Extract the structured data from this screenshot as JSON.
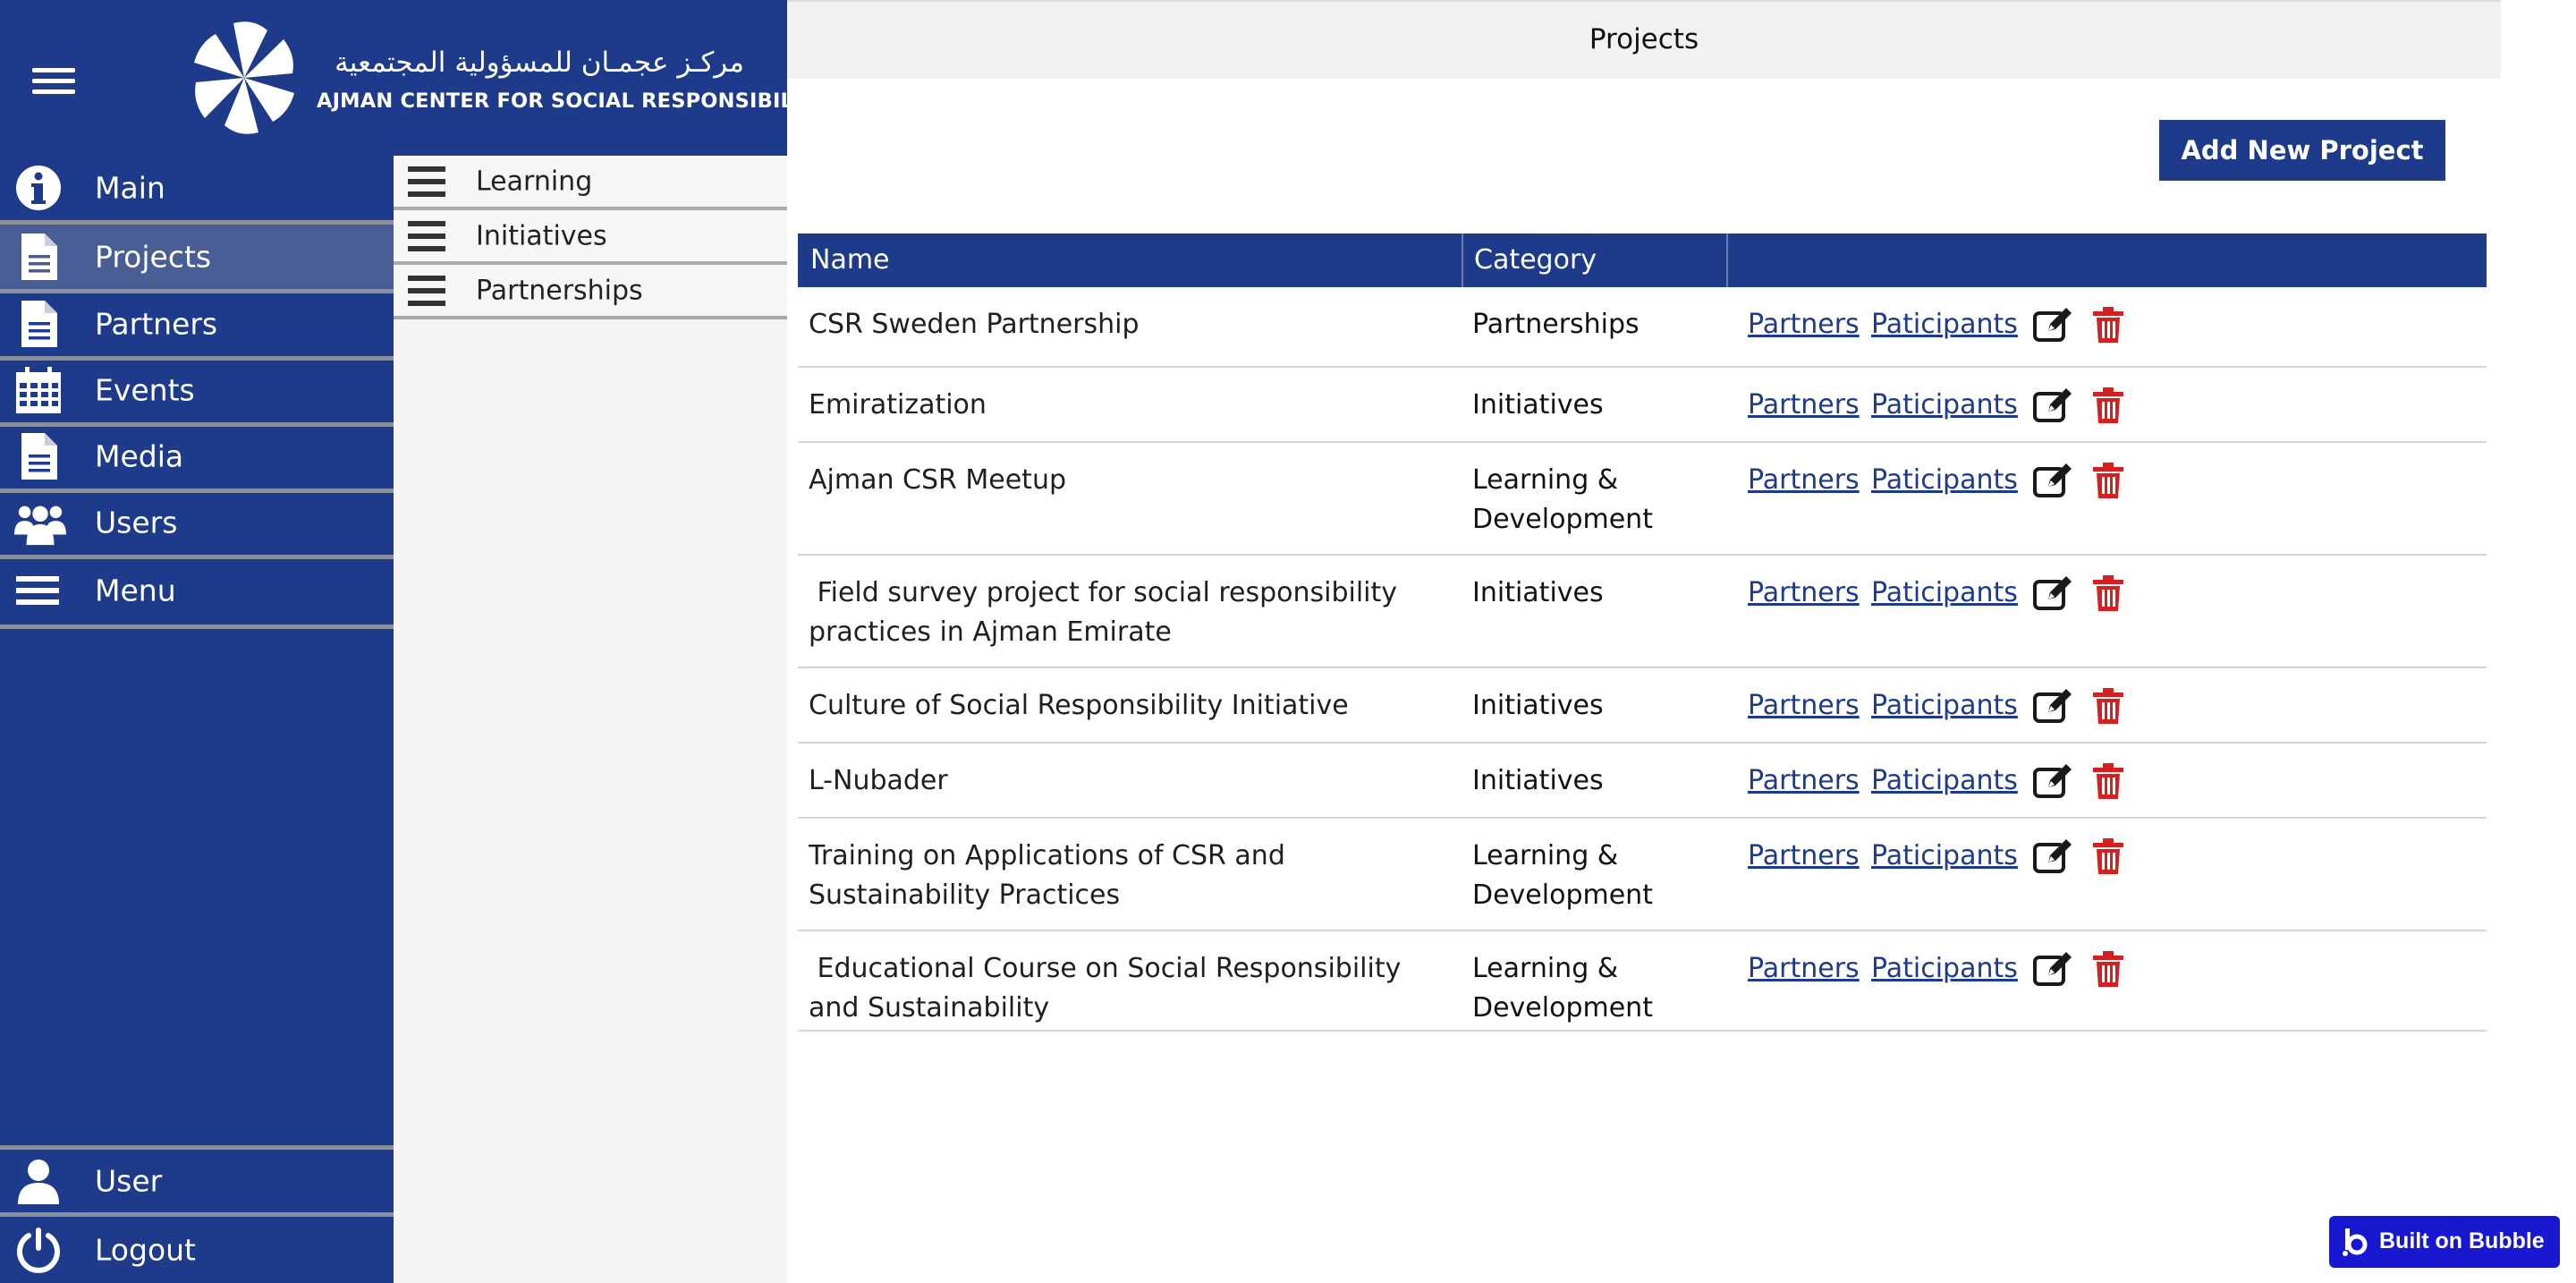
{
  "colors": {
    "brand": "#1e3a8a",
    "active_nav": "#4a5e96",
    "delete": "#d32020",
    "bubble": "#1818d0"
  },
  "logo": {
    "arabic": "مركـز عجمـان للمسؤولية المجتمعية",
    "english": "AJMAN CENTER FOR SOCIAL RESPONSIBILITY",
    "icon": "pinwheel-logo"
  },
  "sidebar": {
    "menu_icon": "hamburger-icon",
    "items": [
      {
        "label": "Main",
        "icon": "info-icon"
      },
      {
        "label": "Projects",
        "icon": "document-icon",
        "active": true
      },
      {
        "label": "Partners",
        "icon": "document-icon"
      },
      {
        "label": "Events",
        "icon": "calendar-icon"
      },
      {
        "label": "Media",
        "icon": "document-icon"
      },
      {
        "label": "Users",
        "icon": "users-icon"
      },
      {
        "label": "Menu",
        "icon": "list-icon"
      }
    ],
    "bottom": [
      {
        "label": "User",
        "icon": "user-icon"
      },
      {
        "label": "Logout",
        "icon": "power-icon"
      }
    ]
  },
  "submenu": {
    "items": [
      {
        "label": "Learning"
      },
      {
        "label": "Initiatives"
      },
      {
        "label": "Partnerships"
      }
    ]
  },
  "header": {
    "title": "Projects"
  },
  "toolbar": {
    "add_label": "Add New Project"
  },
  "table": {
    "columns": [
      "Name",
      "Category",
      ""
    ],
    "link_partners": "Partners",
    "link_participants": "Paticipants",
    "rows": [
      {
        "name": "CSR Sweden Partnership",
        "category": "Partnerships"
      },
      {
        "name": "Emiratization",
        "category": "Initiatives"
      },
      {
        "name": "Ajman CSR Meetup",
        "category": "Learning & Development"
      },
      {
        "name": " Field survey project for social responsibility practices in Ajman Emirate",
        "category": "Initiatives"
      },
      {
        "name": "Culture of Social Responsibility Initiative",
        "category": "Initiatives"
      },
      {
        "name": "L-Nubader",
        "category": "Initiatives"
      },
      {
        "name": "Training on Applications of CSR and Sustainability Practices",
        "category": "Learning & Development"
      },
      {
        "name": " Educational Course on Social Responsibility and Sustainability",
        "category": "Learning & Development"
      }
    ]
  },
  "badge": {
    "label": "Built on Bubble",
    "icon": "bubble-icon"
  }
}
